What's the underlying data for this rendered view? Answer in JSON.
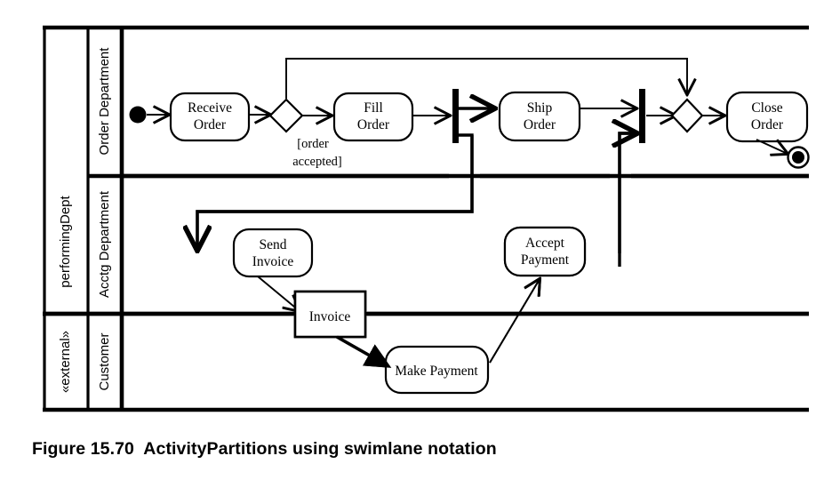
{
  "figure": {
    "caption": "Figure 15.70  ActivityPartitions using swimlane notation"
  },
  "partitions": {
    "outer": [
      {
        "id": "performing-dept",
        "label": "performingDept"
      },
      {
        "id": "external",
        "label": "«external»"
      }
    ],
    "lanes": [
      {
        "id": "order-department",
        "label": "Order Department"
      },
      {
        "id": "acctg-department",
        "label": "Acctg Department"
      },
      {
        "id": "customer",
        "label": "Customer"
      }
    ]
  },
  "nodes": {
    "initial": {
      "name": "initial-node",
      "label": ""
    },
    "receive_order": {
      "label_line1": "Receive",
      "label_line2": "Order"
    },
    "decision": {
      "label": ""
    },
    "fill_order": {
      "label_line1": "Fill",
      "label_line2": "Order"
    },
    "ship_order": {
      "label_line1": "Ship",
      "label_line2": "Order"
    },
    "close_order": {
      "label_line1": "Close",
      "label_line2": "Order"
    },
    "send_invoice": {
      "label_line1": "Send",
      "label_line2": "Invoice"
    },
    "accept_payment": {
      "label_line1": "Accept",
      "label_line2": "Payment"
    },
    "invoice_object": {
      "label": "Invoice"
    },
    "make_payment": {
      "label": "Make Payment"
    },
    "final": {
      "name": "activity-final-node",
      "label": ""
    }
  },
  "guards": {
    "order_accepted_line1": "[order",
    "order_accepted_line2": "accepted]"
  },
  "colors": {
    "stroke": "#000000",
    "fill": "#ffffff",
    "background": "#ffffff"
  }
}
